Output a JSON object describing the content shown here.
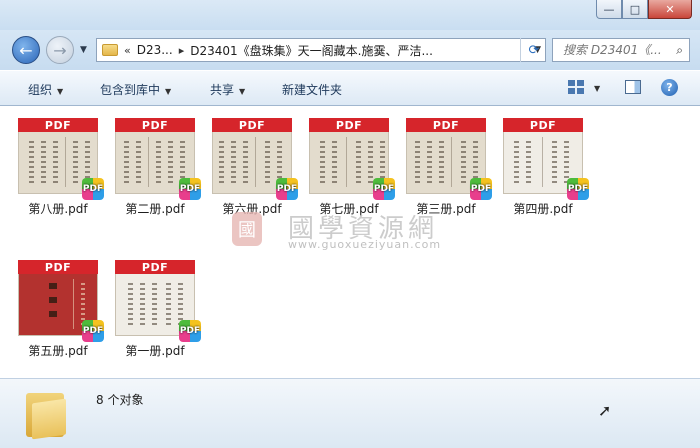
{
  "window": {
    "minimize_icon": "minimize-icon",
    "maximize_icon": "maximize-icon",
    "close_icon": "close-icon"
  },
  "address": {
    "overflow": "«",
    "crumb1": "D23...",
    "crumb2": "D23401《盘珠集》天一阁藏本.施霙、严洁..."
  },
  "search": {
    "placeholder": "搜索 D23401《..."
  },
  "toolbar": {
    "organize": "组织",
    "include_in_library": "包含到库中",
    "share": "共享",
    "new_folder": "新建文件夹"
  },
  "files": [
    {
      "name": "第八册.pdf",
      "band": "PDF",
      "badge": "PDF"
    },
    {
      "name": "第二册.pdf",
      "band": "PDF",
      "badge": "PDF"
    },
    {
      "name": "第六册.pdf",
      "band": "PDF",
      "badge": "PDF"
    },
    {
      "name": "第七册.pdf",
      "band": "PDF",
      "badge": "PDF"
    },
    {
      "name": "第三册.pdf",
      "band": "PDF",
      "badge": "PDF"
    },
    {
      "name": "第四册.pdf",
      "band": "PDF",
      "badge": "PDF"
    },
    {
      "name": "第五册.pdf",
      "band": "PDF",
      "badge": "PDF"
    },
    {
      "name": "第一册.pdf",
      "band": "PDF",
      "badge": "PDF"
    }
  ],
  "watermark": {
    "seal": "國",
    "title": "國學資源網",
    "url": "www.guoxueziyuan.com"
  },
  "status": {
    "count_text": "8 个对象"
  },
  "colors": {
    "pdf_red": "#d6252b",
    "toolbar_text": "#1e395b"
  }
}
